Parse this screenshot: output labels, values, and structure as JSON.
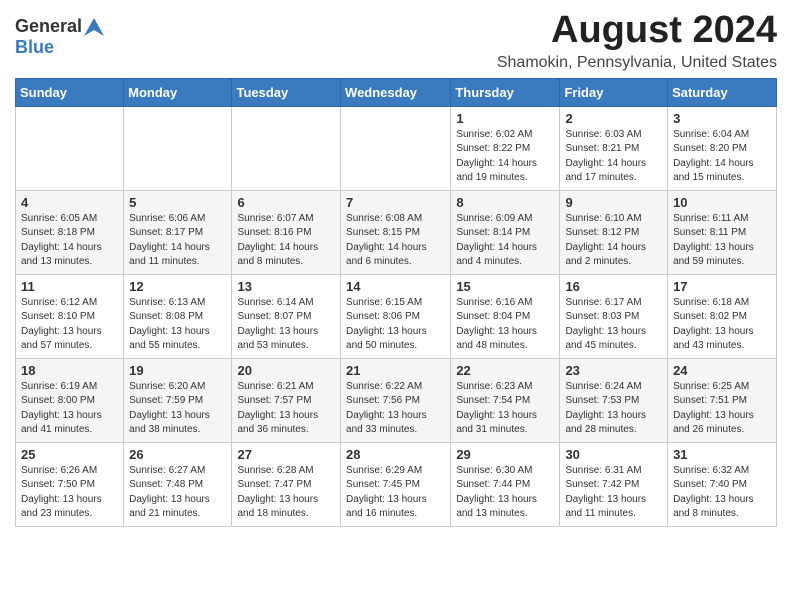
{
  "logo": {
    "general": "General",
    "blue": "Blue"
  },
  "title": "August 2024",
  "location": "Shamokin, Pennsylvania, United States",
  "days_header": [
    "Sunday",
    "Monday",
    "Tuesday",
    "Wednesday",
    "Thursday",
    "Friday",
    "Saturday"
  ],
  "weeks": [
    [
      {
        "day": "",
        "sunrise": "",
        "sunset": "",
        "daylight": ""
      },
      {
        "day": "",
        "sunrise": "",
        "sunset": "",
        "daylight": ""
      },
      {
        "day": "",
        "sunrise": "",
        "sunset": "",
        "daylight": ""
      },
      {
        "day": "",
        "sunrise": "",
        "sunset": "",
        "daylight": ""
      },
      {
        "day": "1",
        "sunrise": "Sunrise: 6:02 AM",
        "sunset": "Sunset: 8:22 PM",
        "daylight": "Daylight: 14 hours and 19 minutes."
      },
      {
        "day": "2",
        "sunrise": "Sunrise: 6:03 AM",
        "sunset": "Sunset: 8:21 PM",
        "daylight": "Daylight: 14 hours and 17 minutes."
      },
      {
        "day": "3",
        "sunrise": "Sunrise: 6:04 AM",
        "sunset": "Sunset: 8:20 PM",
        "daylight": "Daylight: 14 hours and 15 minutes."
      }
    ],
    [
      {
        "day": "4",
        "sunrise": "Sunrise: 6:05 AM",
        "sunset": "Sunset: 8:18 PM",
        "daylight": "Daylight: 14 hours and 13 minutes."
      },
      {
        "day": "5",
        "sunrise": "Sunrise: 6:06 AM",
        "sunset": "Sunset: 8:17 PM",
        "daylight": "Daylight: 14 hours and 11 minutes."
      },
      {
        "day": "6",
        "sunrise": "Sunrise: 6:07 AM",
        "sunset": "Sunset: 8:16 PM",
        "daylight": "Daylight: 14 hours and 8 minutes."
      },
      {
        "day": "7",
        "sunrise": "Sunrise: 6:08 AM",
        "sunset": "Sunset: 8:15 PM",
        "daylight": "Daylight: 14 hours and 6 minutes."
      },
      {
        "day": "8",
        "sunrise": "Sunrise: 6:09 AM",
        "sunset": "Sunset: 8:14 PM",
        "daylight": "Daylight: 14 hours and 4 minutes."
      },
      {
        "day": "9",
        "sunrise": "Sunrise: 6:10 AM",
        "sunset": "Sunset: 8:12 PM",
        "daylight": "Daylight: 14 hours and 2 minutes."
      },
      {
        "day": "10",
        "sunrise": "Sunrise: 6:11 AM",
        "sunset": "Sunset: 8:11 PM",
        "daylight": "Daylight: 13 hours and 59 minutes."
      }
    ],
    [
      {
        "day": "11",
        "sunrise": "Sunrise: 6:12 AM",
        "sunset": "Sunset: 8:10 PM",
        "daylight": "Daylight: 13 hours and 57 minutes."
      },
      {
        "day": "12",
        "sunrise": "Sunrise: 6:13 AM",
        "sunset": "Sunset: 8:08 PM",
        "daylight": "Daylight: 13 hours and 55 minutes."
      },
      {
        "day": "13",
        "sunrise": "Sunrise: 6:14 AM",
        "sunset": "Sunset: 8:07 PM",
        "daylight": "Daylight: 13 hours and 53 minutes."
      },
      {
        "day": "14",
        "sunrise": "Sunrise: 6:15 AM",
        "sunset": "Sunset: 8:06 PM",
        "daylight": "Daylight: 13 hours and 50 minutes."
      },
      {
        "day": "15",
        "sunrise": "Sunrise: 6:16 AM",
        "sunset": "Sunset: 8:04 PM",
        "daylight": "Daylight: 13 hours and 48 minutes."
      },
      {
        "day": "16",
        "sunrise": "Sunrise: 6:17 AM",
        "sunset": "Sunset: 8:03 PM",
        "daylight": "Daylight: 13 hours and 45 minutes."
      },
      {
        "day": "17",
        "sunrise": "Sunrise: 6:18 AM",
        "sunset": "Sunset: 8:02 PM",
        "daylight": "Daylight: 13 hours and 43 minutes."
      }
    ],
    [
      {
        "day": "18",
        "sunrise": "Sunrise: 6:19 AM",
        "sunset": "Sunset: 8:00 PM",
        "daylight": "Daylight: 13 hours and 41 minutes."
      },
      {
        "day": "19",
        "sunrise": "Sunrise: 6:20 AM",
        "sunset": "Sunset: 7:59 PM",
        "daylight": "Daylight: 13 hours and 38 minutes."
      },
      {
        "day": "20",
        "sunrise": "Sunrise: 6:21 AM",
        "sunset": "Sunset: 7:57 PM",
        "daylight": "Daylight: 13 hours and 36 minutes."
      },
      {
        "day": "21",
        "sunrise": "Sunrise: 6:22 AM",
        "sunset": "Sunset: 7:56 PM",
        "daylight": "Daylight: 13 hours and 33 minutes."
      },
      {
        "day": "22",
        "sunrise": "Sunrise: 6:23 AM",
        "sunset": "Sunset: 7:54 PM",
        "daylight": "Daylight: 13 hours and 31 minutes."
      },
      {
        "day": "23",
        "sunrise": "Sunrise: 6:24 AM",
        "sunset": "Sunset: 7:53 PM",
        "daylight": "Daylight: 13 hours and 28 minutes."
      },
      {
        "day": "24",
        "sunrise": "Sunrise: 6:25 AM",
        "sunset": "Sunset: 7:51 PM",
        "daylight": "Daylight: 13 hours and 26 minutes."
      }
    ],
    [
      {
        "day": "25",
        "sunrise": "Sunrise: 6:26 AM",
        "sunset": "Sunset: 7:50 PM",
        "daylight": "Daylight: 13 hours and 23 minutes."
      },
      {
        "day": "26",
        "sunrise": "Sunrise: 6:27 AM",
        "sunset": "Sunset: 7:48 PM",
        "daylight": "Daylight: 13 hours and 21 minutes."
      },
      {
        "day": "27",
        "sunrise": "Sunrise: 6:28 AM",
        "sunset": "Sunset: 7:47 PM",
        "daylight": "Daylight: 13 hours and 18 minutes."
      },
      {
        "day": "28",
        "sunrise": "Sunrise: 6:29 AM",
        "sunset": "Sunset: 7:45 PM",
        "daylight": "Daylight: 13 hours and 16 minutes."
      },
      {
        "day": "29",
        "sunrise": "Sunrise: 6:30 AM",
        "sunset": "Sunset: 7:44 PM",
        "daylight": "Daylight: 13 hours and 13 minutes."
      },
      {
        "day": "30",
        "sunrise": "Sunrise: 6:31 AM",
        "sunset": "Sunset: 7:42 PM",
        "daylight": "Daylight: 13 hours and 11 minutes."
      },
      {
        "day": "31",
        "sunrise": "Sunrise: 6:32 AM",
        "sunset": "Sunset: 7:40 PM",
        "daylight": "Daylight: 13 hours and 8 minutes."
      }
    ]
  ]
}
